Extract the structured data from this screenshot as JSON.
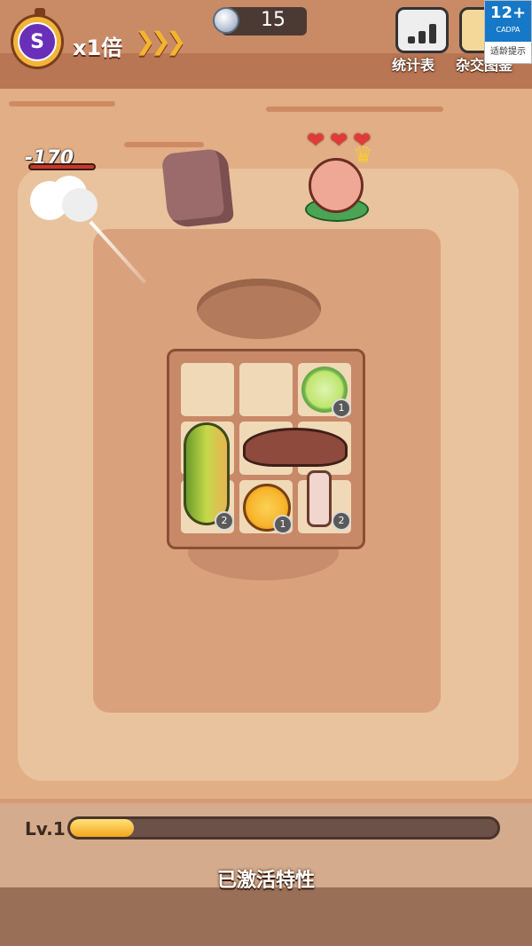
{
  "hud": {
    "speed_label": "x1倍",
    "speed_badge_letter": "S",
    "speed_arrows": "❯❯❯",
    "coins": "15",
    "stats_button_label": "统计表",
    "hybrid_button_label": "杂交图鉴",
    "age_rating": "12+",
    "age_rating_org": "CADPA",
    "age_rating_note": "适龄提示"
  },
  "battle": {
    "damage_text": "-170",
    "boss_hearts": [
      "❤",
      "❤",
      "❤"
    ],
    "boss_crown_icon": "crown-icon"
  },
  "backpack": {
    "items": [
      {
        "name": "cucumber-slice",
        "count": "1"
      },
      {
        "name": "loofah",
        "count": "2"
      },
      {
        "name": "orange-slice",
        "count": "1"
      },
      {
        "name": "mushroom-stem",
        "count": "2"
      }
    ]
  },
  "footer": {
    "level_label": "Lv.1",
    "xp_progress": 0.15,
    "traits_label": "已激活特性"
  },
  "colors": {
    "accent_gold": "#f2b431",
    "purple": "#6a2fb8",
    "age_blue": "#1678c8",
    "heart_red": "#e23a3a"
  }
}
